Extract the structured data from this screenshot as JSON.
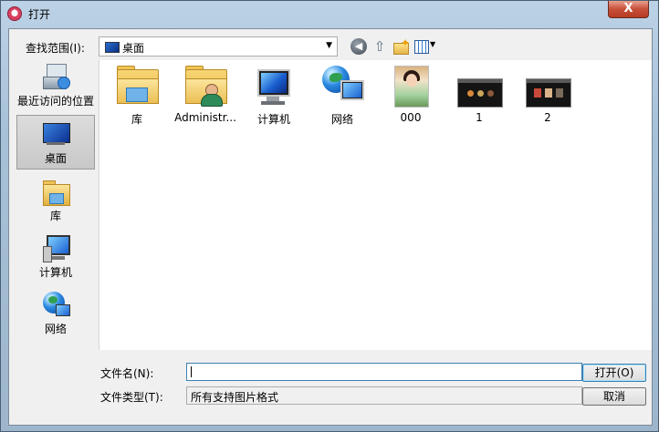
{
  "window": {
    "title": "打开",
    "close_symbol": "X"
  },
  "toolbar": {
    "look_in_label": "查找范围(I):",
    "look_in_value": "桌面",
    "dropdown_symbol": "▼",
    "back_symbol": "◀",
    "up_symbol": "⇧",
    "views_arrow": "▼"
  },
  "sidebar": {
    "items": [
      {
        "label": "最近访问的位置",
        "icon": "recent-places-icon"
      },
      {
        "label": "桌面",
        "icon": "desktop-icon",
        "selected": true
      },
      {
        "label": "库",
        "icon": "library-icon"
      },
      {
        "label": "计算机",
        "icon": "computer-icon"
      },
      {
        "label": "网络",
        "icon": "network-icon"
      }
    ]
  },
  "files": [
    {
      "name": "库",
      "icon": "library-folder-icon"
    },
    {
      "name": "Administr...",
      "icon": "user-folder-icon"
    },
    {
      "name": "计算机",
      "icon": "computer-icon"
    },
    {
      "name": "网络",
      "icon": "network-icon"
    },
    {
      "name": "000",
      "icon": "image-thumbnail"
    },
    {
      "name": "1",
      "icon": "image-thumbnail"
    },
    {
      "name": "2",
      "icon": "image-thumbnail"
    }
  ],
  "footer": {
    "filename_label": "文件名(N):",
    "filename_value": "",
    "filetype_label": "文件类型(T):",
    "filetype_value": "所有支持图片格式",
    "open_label": "打开(O)",
    "cancel_label": "取消"
  }
}
